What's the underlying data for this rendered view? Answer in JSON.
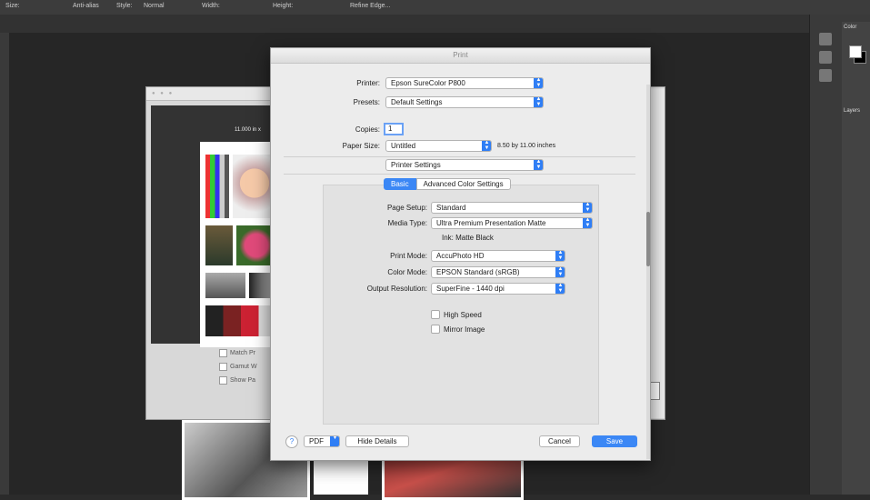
{
  "ps": {
    "options": [
      "Size:",
      "Anti-alias",
      "Style:",
      "Normal",
      "Width:",
      "Height:",
      "Refine Edge..."
    ],
    "panel_color_title": "Color",
    "panel_layers_title": "Layers"
  },
  "bg_dialog": {
    "paper_size_label": "11.000 in x",
    "checks": [
      "Match Pr",
      "Gamut W",
      "Show Pa"
    ]
  },
  "print": {
    "title": "Print",
    "printer_label": "Printer:",
    "printer_value": "Epson SureColor P800",
    "presets_label": "Presets:",
    "presets_value": "Default Settings",
    "copies_label": "Copies:",
    "copies_value": "1",
    "paper_size_label": "Paper Size:",
    "paper_size_value": "Untitled",
    "paper_size_dims": "8.50 by 11.00 inches",
    "pane_value": "Printer Settings",
    "tab_basic": "Basic",
    "tab_advanced": "Advanced Color Settings",
    "page_setup_label": "Page Setup:",
    "page_setup_value": "Standard",
    "media_type_label": "Media Type:",
    "media_type_value": "Ultra Premium Presentation Matte",
    "ink_text": "Ink: Matte Black",
    "print_mode_label": "Print Mode:",
    "print_mode_value": "AccuPhoto HD",
    "color_mode_label": "Color Mode:",
    "color_mode_value": "EPSON Standard (sRGB)",
    "output_res_label": "Output Resolution:",
    "output_res_value": "SuperFine - 1440 dpi",
    "high_speed_label": "High Speed",
    "mirror_image_label": "Mirror Image",
    "help_label": "?",
    "pdf_label": "PDF",
    "hide_details_label": "Hide Details",
    "cancel_label": "Cancel",
    "save_label": "Save"
  },
  "colors": {
    "accent": "#3b87f5",
    "ps_bg": "#262626"
  },
  "icons": [
    "chevron-updown-icon",
    "help-icon",
    "checkbox-icon"
  ]
}
